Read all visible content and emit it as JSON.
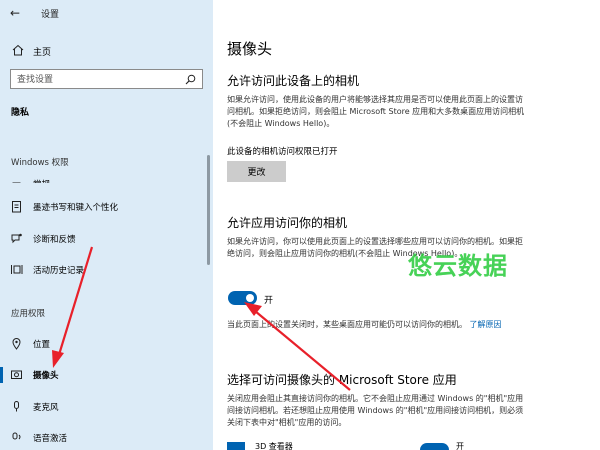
{
  "window": {
    "title": "设置"
  },
  "sidebar": {
    "home_label": "主页",
    "search_placeholder": "查找设置",
    "section_title": "隐私",
    "windows_group": "Windows 权限",
    "windows_items": [
      {
        "label": "常规"
      },
      {
        "label": "墨迹书写和键入个性化"
      },
      {
        "label": "诊断和反馈"
      },
      {
        "label": "活动历史记录"
      }
    ],
    "app_group": "应用权限",
    "app_items": [
      {
        "label": "位置"
      },
      {
        "label": "摄像头"
      },
      {
        "label": "麦克风"
      },
      {
        "label": "语音激活"
      }
    ]
  },
  "main": {
    "title": "摄像头",
    "device_section": {
      "heading": "允许访问此设备上的相机",
      "description": "如果允许访问，使用此设备的用户将能够选择其应用是否可以使用此页面上的设置访问相机。如果拒绝访问，则会阻止 Microsoft Store 应用和大多数桌面应用访问相机(不会阻止 Windows Hello)。",
      "status": "此设备的相机访问权限已打开",
      "change_button": "更改"
    },
    "app_section": {
      "heading": "允许应用访问你的相机",
      "description": "如果允许访问，你可以使用此页面上的设置选择哪些应用可以访问你的相机。如果拒绝访问，则会阻止应用访问你的相机(不会阻止 Windows Hello)。",
      "toggle_state": "开",
      "toggle_on": true,
      "note": "当此页面上的设置关闭时，某些桌面应用可能仍可以访问你的相机。",
      "note_link": "了解原因"
    },
    "store_section": {
      "heading": "选择可访问摄像头的 Microsoft Store 应用",
      "description": "关闭应用会阻止其直接访问你的相机。它不会阻止应用通过 Windows 的\"相机\"应用间接访问相机。若还想阻止应用使用 Windows 的\"相机\"应用间接访问相机，则必须关闭下表中对\"相机\"应用的访问。",
      "app_name": "3D 查看器",
      "toggle_state": "开"
    }
  },
  "watermark": "悠云数据",
  "colors": {
    "sidebar_bg": "#dcebf7",
    "accent": "#0063b1",
    "arrow": "#e8202a",
    "watermark": "#2ecc40"
  }
}
